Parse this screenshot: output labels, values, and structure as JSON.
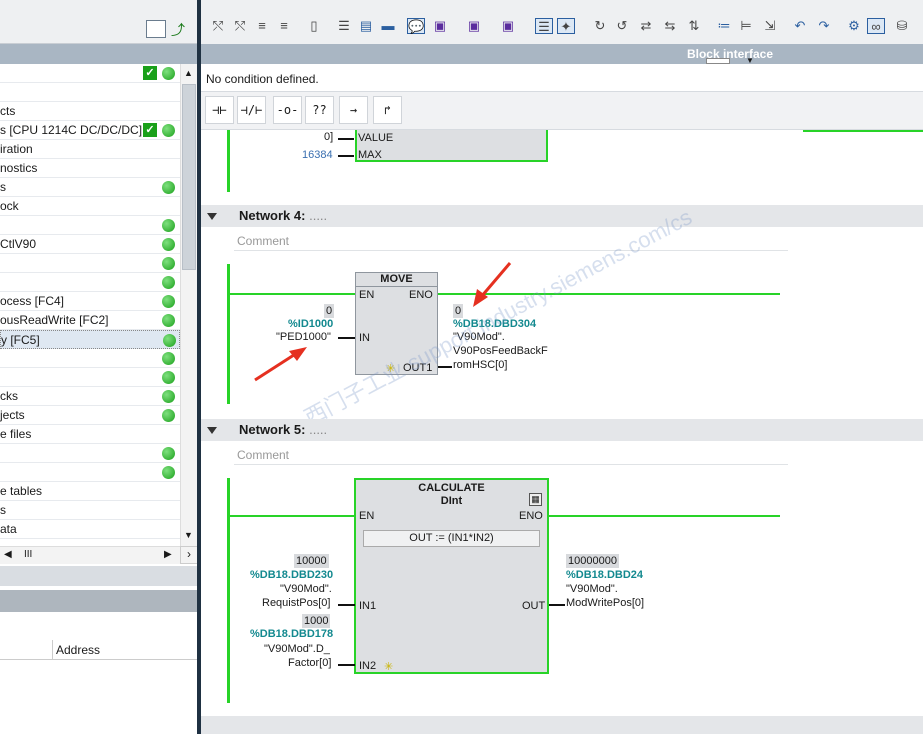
{
  "left_tree": [
    {
      "text": "",
      "status": "check+dot"
    },
    {
      "text": "",
      "status": ""
    },
    {
      "text": "cts",
      "status": ""
    },
    {
      "text": "s [CPU 1214C DC/DC/DC]",
      "status": "check+dot"
    },
    {
      "text": "iration",
      "status": ""
    },
    {
      "text": "nostics",
      "status": ""
    },
    {
      "text": "s",
      "status": "dot"
    },
    {
      "text": "ock",
      "status": ""
    },
    {
      "text": "",
      "status": "dot"
    },
    {
      "text": "CtlV90",
      "status": "dot"
    },
    {
      "text": "",
      "status": "dot"
    },
    {
      "text": "",
      "status": "dot"
    },
    {
      "text": "ocess [FC4]",
      "status": "dot"
    },
    {
      "text": "ousReadWrite [FC2]",
      "status": "dot"
    },
    {
      "text": "y [FC5]",
      "status": "dot",
      "selected": true
    },
    {
      "text": "",
      "status": "dot"
    },
    {
      "text": "",
      "status": "dot"
    },
    {
      "text": "cks",
      "status": "dot"
    },
    {
      "text": "jects",
      "status": "dot"
    },
    {
      "text": "e files",
      "status": ""
    },
    {
      "text": "",
      "status": "dot"
    },
    {
      "text": "",
      "status": "dot"
    },
    {
      "text": "e tables",
      "status": ""
    },
    {
      "text": "s",
      "status": ""
    },
    {
      "text": "ata",
      "status": ""
    }
  ],
  "left_bottom": {
    "address_col": "Address",
    "hscroll_glyph": "III"
  },
  "block_interface_label": "Block interface",
  "condition_text": "No condition defined.",
  "ladder_buttons": [
    "⊣⊢",
    "⊣/⊢",
    "-o-",
    "??",
    "→",
    "↱"
  ],
  "net_top": {
    "val0": "0]",
    "pin_value": "VALUE",
    "val_max": "16384",
    "pin_max": "MAX"
  },
  "network4": {
    "title": "Network 4:",
    "dots": ".....",
    "comment": "Comment",
    "block": "MOVE",
    "en": "EN",
    "eno": "ENO",
    "in": "IN",
    "out1": "OUT1",
    "in_value": "0",
    "in_addr": "%ID1000",
    "in_name": "\"PED1000\"",
    "out_value": "0",
    "out_addr": "%DB18.DBD304",
    "out_name1": "\"V90Mod\".",
    "out_name2": "V90PosFeedBackF",
    "out_name3": "romHSC[0]"
  },
  "network5": {
    "title": "Network 5:",
    "dots": ".....",
    "comment": "Comment",
    "block": "CALCULATE",
    "type": "DInt",
    "en": "EN",
    "eno": "ENO",
    "formula": "OUT :=   (IN1*IN2)",
    "in1": "IN1",
    "in2": "IN2",
    "out": "OUT",
    "in1_value": "10000",
    "in1_addr": "%DB18.DBD230",
    "in1_name1": "\"V90Mod\".",
    "in1_name2": "RequistPos[0]",
    "in2_value": "1000",
    "in2_addr": "%DB18.DBD178",
    "in2_name1": "\"V90Mod\".D_",
    "in2_name2": "Factor[0]",
    "out_value": "10000000",
    "out_addr": "%DB18.DBD24",
    "out_name1": "\"V90Mod\".",
    "out_name2": "ModWritePos[0]"
  },
  "watermark": "西门子工业 support.industry.siemens.com/cs"
}
